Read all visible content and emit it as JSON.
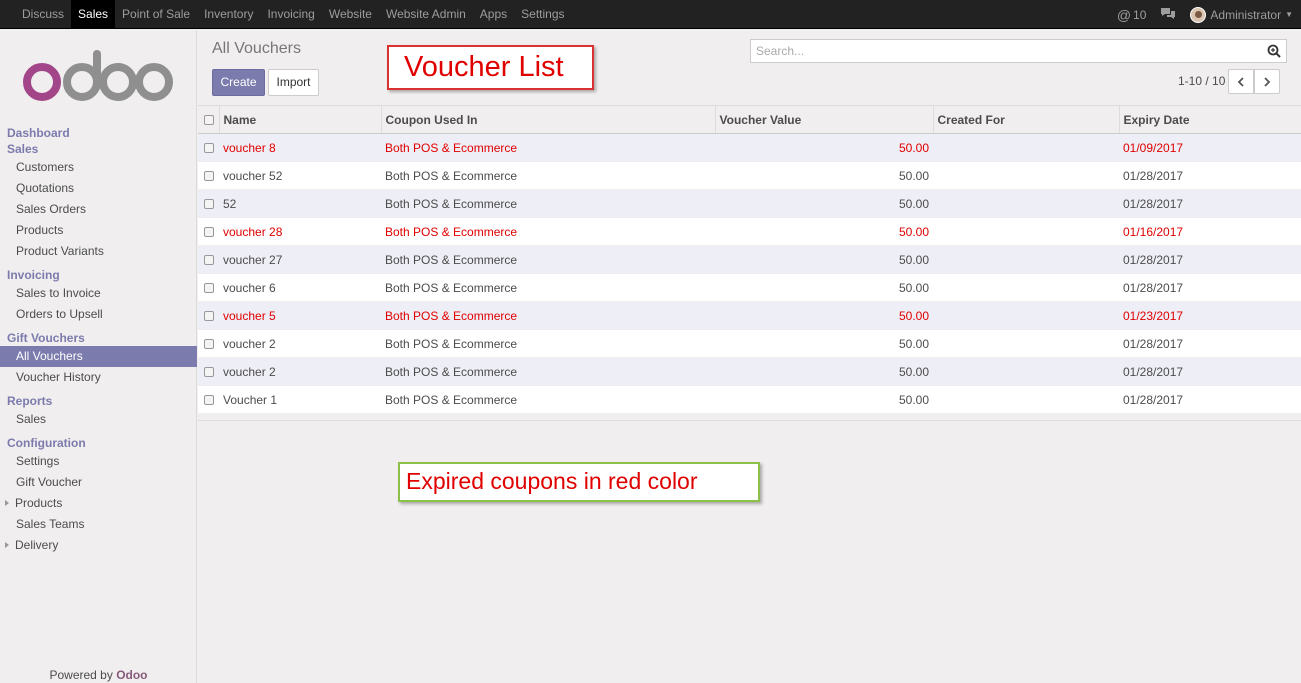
{
  "topbar": {
    "menu": [
      {
        "label": "Discuss",
        "active": false
      },
      {
        "label": "Sales",
        "active": true
      },
      {
        "label": "Point of Sale",
        "active": false
      },
      {
        "label": "Inventory",
        "active": false
      },
      {
        "label": "Invoicing",
        "active": false
      },
      {
        "label": "Website",
        "active": false
      },
      {
        "label": "Website Admin",
        "active": false
      },
      {
        "label": "Apps",
        "active": false
      },
      {
        "label": "Settings",
        "active": false
      }
    ],
    "mentions_count": "10",
    "user_name": "Administrator"
  },
  "sidebar": {
    "logo_text": "odoo",
    "sections": [
      {
        "header": "Dashboard",
        "items": []
      },
      {
        "header": "Sales",
        "items": [
          "Customers",
          "Quotations",
          "Sales Orders",
          "Products",
          "Product Variants"
        ]
      },
      {
        "header": "Invoicing",
        "items": [
          "Sales to Invoice",
          "Orders to Upsell"
        ]
      },
      {
        "header": "Gift Vouchers",
        "items": [
          "All Vouchers",
          "Voucher History"
        ]
      },
      {
        "header": "Reports",
        "items": [
          "Sales"
        ]
      },
      {
        "header": "Configuration",
        "items": [
          "Settings",
          "Gift Voucher",
          "Products",
          "Sales Teams",
          "Delivery"
        ]
      }
    ],
    "active_item": "All Vouchers",
    "powered_by": "Powered by",
    "powered_brand": "Odoo"
  },
  "control_panel": {
    "title": "All Vouchers",
    "create_label": "Create",
    "import_label": "Import",
    "search_placeholder": "Search...",
    "pager": "1-10 / 10"
  },
  "annotations": {
    "voucher_list": "Voucher List",
    "expired_note": "Expired coupons in red color"
  },
  "table": {
    "columns": [
      "Name",
      "Coupon Used In",
      "Voucher Value",
      "Created For",
      "Expiry Date"
    ],
    "rows": [
      {
        "name": "voucher 8",
        "used_in": "Both POS & Ecommerce",
        "value": "50.00",
        "created_for": "",
        "expiry": "01/09/2017",
        "expired": true
      },
      {
        "name": "voucher 52",
        "used_in": "Both POS & Ecommerce",
        "value": "50.00",
        "created_for": "",
        "expiry": "01/28/2017",
        "expired": false
      },
      {
        "name": "52",
        "used_in": "Both POS & Ecommerce",
        "value": "50.00",
        "created_for": "",
        "expiry": "01/28/2017",
        "expired": false
      },
      {
        "name": "voucher 28",
        "used_in": "Both POS & Ecommerce",
        "value": "50.00",
        "created_for": "",
        "expiry": "01/16/2017",
        "expired": true
      },
      {
        "name": "voucher 27",
        "used_in": "Both POS & Ecommerce",
        "value": "50.00",
        "created_for": "",
        "expiry": "01/28/2017",
        "expired": false
      },
      {
        "name": "voucher 6",
        "used_in": "Both POS & Ecommerce",
        "value": "50.00",
        "created_for": "",
        "expiry": "01/28/2017",
        "expired": false
      },
      {
        "name": "voucher 5",
        "used_in": "Both POS & Ecommerce",
        "value": "50.00",
        "created_for": "",
        "expiry": "01/23/2017",
        "expired": true
      },
      {
        "name": "voucher 2",
        "used_in": "Both POS & Ecommerce",
        "value": "50.00",
        "created_for": "",
        "expiry": "01/28/2017",
        "expired": false
      },
      {
        "name": "voucher 2",
        "used_in": "Both POS & Ecommerce",
        "value": "50.00",
        "created_for": "",
        "expiry": "01/28/2017",
        "expired": false
      },
      {
        "name": "Voucher 1",
        "used_in": "Both POS & Ecommerce",
        "value": "50.00",
        "created_for": "",
        "expiry": "01/28/2017",
        "expired": false
      }
    ]
  },
  "colors": {
    "brand": "#7c7bad",
    "expired": "#e00000",
    "logo": "#875a7b"
  }
}
